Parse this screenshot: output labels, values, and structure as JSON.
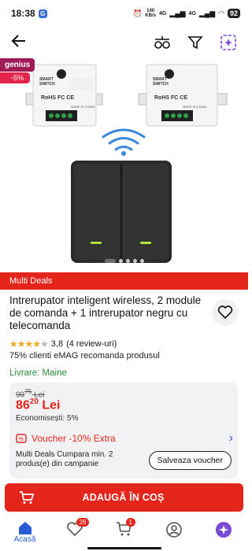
{
  "status_bar": {
    "time": "18:38",
    "speed_value": "140",
    "speed_unit": "KB/s",
    "network1": "4G",
    "network2": "4G",
    "battery": "92"
  },
  "app_bar": {
    "icons": [
      "back-arrow-icon",
      "compare-icon",
      "filter-icon",
      "ai-sparkle-icon"
    ]
  },
  "gallery": {
    "genius_label": "genius",
    "discount_label": "-5%",
    "module_label_line1": "SMART",
    "module_label_line2": "SWITCH",
    "module_made_in": "MADE IN CHINA",
    "dots_total": 5,
    "dots_active": 1
  },
  "deals_strip": "Multi Deals",
  "product": {
    "title": "Intrerupator inteligent wireless, 2 module de comanda + 1 intrerupator negru cu telecomanda",
    "rating_value": "3,8",
    "review_count": "(4 review-uri)",
    "recommend": "75% clienti eMAG recomanda produsul",
    "delivery": "Livrare: Maine"
  },
  "price": {
    "old_price_int": "90",
    "old_price_dec": "75",
    "old_currency": "Lei",
    "new_price_int": "86",
    "new_price_dec": "20",
    "new_currency": "Lei",
    "savings": "Economisești: 5%"
  },
  "voucher": {
    "title": "Voucher -10% Extra",
    "description": "Multi Deals Cumpara min. 2 produs(e) din campanie",
    "button_label": "Salveaza voucher"
  },
  "cart_button": "ADAUGĂ ÎN COȘ",
  "nav": {
    "home_label": "Acasă",
    "favorites_badge": "26",
    "cart_badge": "1"
  },
  "colors": {
    "brand_red": "#e4251b",
    "genius_purple": "#a01c55",
    "link_blue": "#2a5bd7",
    "delivery_green": "#2b8a3e"
  }
}
